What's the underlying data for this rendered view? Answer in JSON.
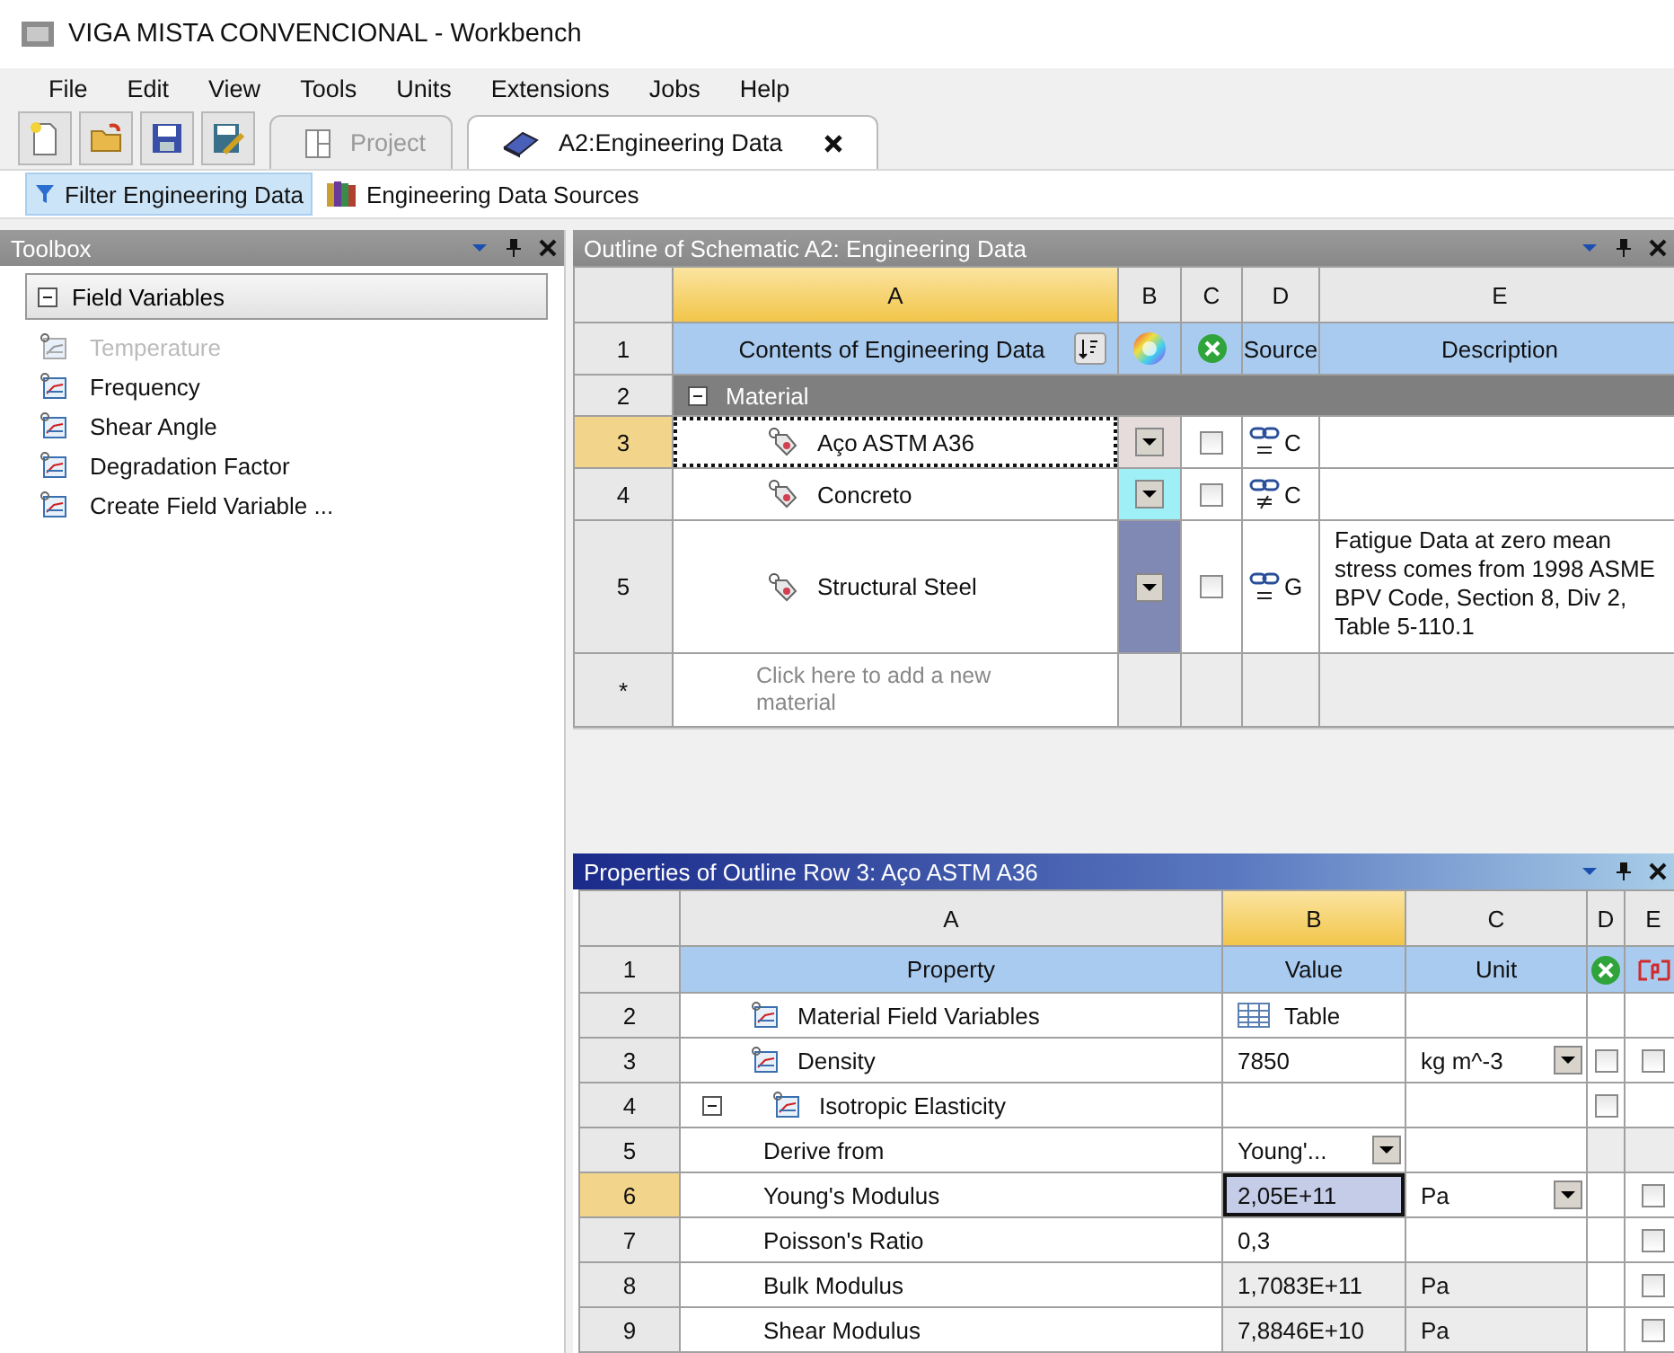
{
  "window": {
    "title": "VIGA MISTA CONVENCIONAL - Workbench"
  },
  "menu": [
    "File",
    "Edit",
    "View",
    "Tools",
    "Units",
    "Extensions",
    "Jobs",
    "Help"
  ],
  "tabs": [
    {
      "label": "Project",
      "selected": false
    },
    {
      "label": "A2:Engineering Data",
      "selected": true
    }
  ],
  "subtoolbar": [
    {
      "label": "Filter Engineering Data",
      "pressed": true
    },
    {
      "label": "Engineering Data Sources",
      "pressed": false
    }
  ],
  "toolbox": {
    "title": "Toolbox",
    "group": {
      "label": "Field Variables",
      "expanded": true,
      "items": [
        {
          "label": "Temperature",
          "disabled": true
        },
        {
          "label": "Frequency",
          "disabled": false
        },
        {
          "label": "Shear Angle",
          "disabled": false
        },
        {
          "label": "Degradation Factor",
          "disabled": false
        },
        {
          "label": "Create Field Variable ...",
          "disabled": false
        }
      ]
    }
  },
  "outline": {
    "title": "Outline of Schematic A2: Engineering Data",
    "columns": [
      {
        "label": "A",
        "selected": true
      },
      {
        "label": "B",
        "selected": false
      },
      {
        "label": "C",
        "selected": false
      },
      {
        "label": "D",
        "selected": false
      },
      {
        "label": "E",
        "selected": false
      }
    ],
    "header": {
      "num": "1",
      "contents": "Contents of Engineering Data",
      "source": "Source",
      "description": "Description"
    },
    "group": {
      "num": "2",
      "label": "Material",
      "expanded": true
    },
    "rows": [
      {
        "num": "3",
        "name": "Aço ASTM A36",
        "color": "#e6dcdc",
        "checked": false,
        "source_changed": false,
        "source": "C",
        "selected": true
      },
      {
        "num": "4",
        "name": "Concreto",
        "color": "#9ef0f6",
        "checked": false,
        "source_changed": true,
        "source": "C",
        "selected": false
      },
      {
        "num": "5",
        "name": "Structural Steel",
        "color": "#8088b4",
        "checked": false,
        "source_changed": false,
        "source": "G",
        "description": "Fatigue Data at zero mean stress comes from 1998 ASME BPV Code, Section 8, Div 2, Table 5-110.1",
        "selected": false
      }
    ],
    "add_row": {
      "num": "*",
      "placeholder": "Click here to add a new material"
    }
  },
  "properties": {
    "title": "Properties of Outline Row 3: Aço ASTM A36",
    "columns": [
      {
        "label": "A",
        "selected": false
      },
      {
        "label": "B",
        "selected": true
      },
      {
        "label": "C",
        "selected": false
      },
      {
        "label": "D",
        "selected": false
      },
      {
        "label": "E",
        "selected": false
      }
    ],
    "header": {
      "num": "1",
      "property": "Property",
      "value": "Value",
      "unit": "Unit"
    },
    "rows": [
      {
        "num": "2",
        "label": "Material Field Variables",
        "kind": "variable",
        "value": "Table",
        "value_table": true,
        "selected": false
      },
      {
        "num": "3",
        "label": "Density",
        "kind": "variable",
        "value": "7850",
        "unit": "kg m^-3",
        "unit_dropdown": true,
        "d_checked": false,
        "e_checked": false,
        "selected": false
      },
      {
        "num": "4",
        "label": "Isotropic Elasticity",
        "kind": "variable",
        "expanded": true,
        "d_checked": false,
        "selected": false,
        "children": [
          {
            "num": "5",
            "label": "Derive from",
            "kind": "parameter",
            "value": "Young'...",
            "value_dropdown": true,
            "locked_de": true,
            "selected": false
          },
          {
            "num": "6",
            "label": "Young's Modulus",
            "kind": "parameter",
            "value": "2,05E+11",
            "unit": "Pa",
            "unit_dropdown": true,
            "e_checked": false,
            "selected": true
          },
          {
            "num": "7",
            "label": "Poisson's Ratio",
            "kind": "parameter",
            "value": "0,3",
            "e_checked": false,
            "selected": false
          },
          {
            "num": "8",
            "label": "Bulk Modulus",
            "kind": "parameter",
            "value": "1,7083E+11",
            "unit": "Pa",
            "read_only": true,
            "e_checked": false,
            "selected": false
          },
          {
            "num": "9",
            "label": "Shear Modulus",
            "kind": "parameter",
            "value": "7,8846E+10",
            "unit": "Pa",
            "read_only": true,
            "e_checked": false,
            "selected": false
          }
        ]
      }
    ]
  }
}
